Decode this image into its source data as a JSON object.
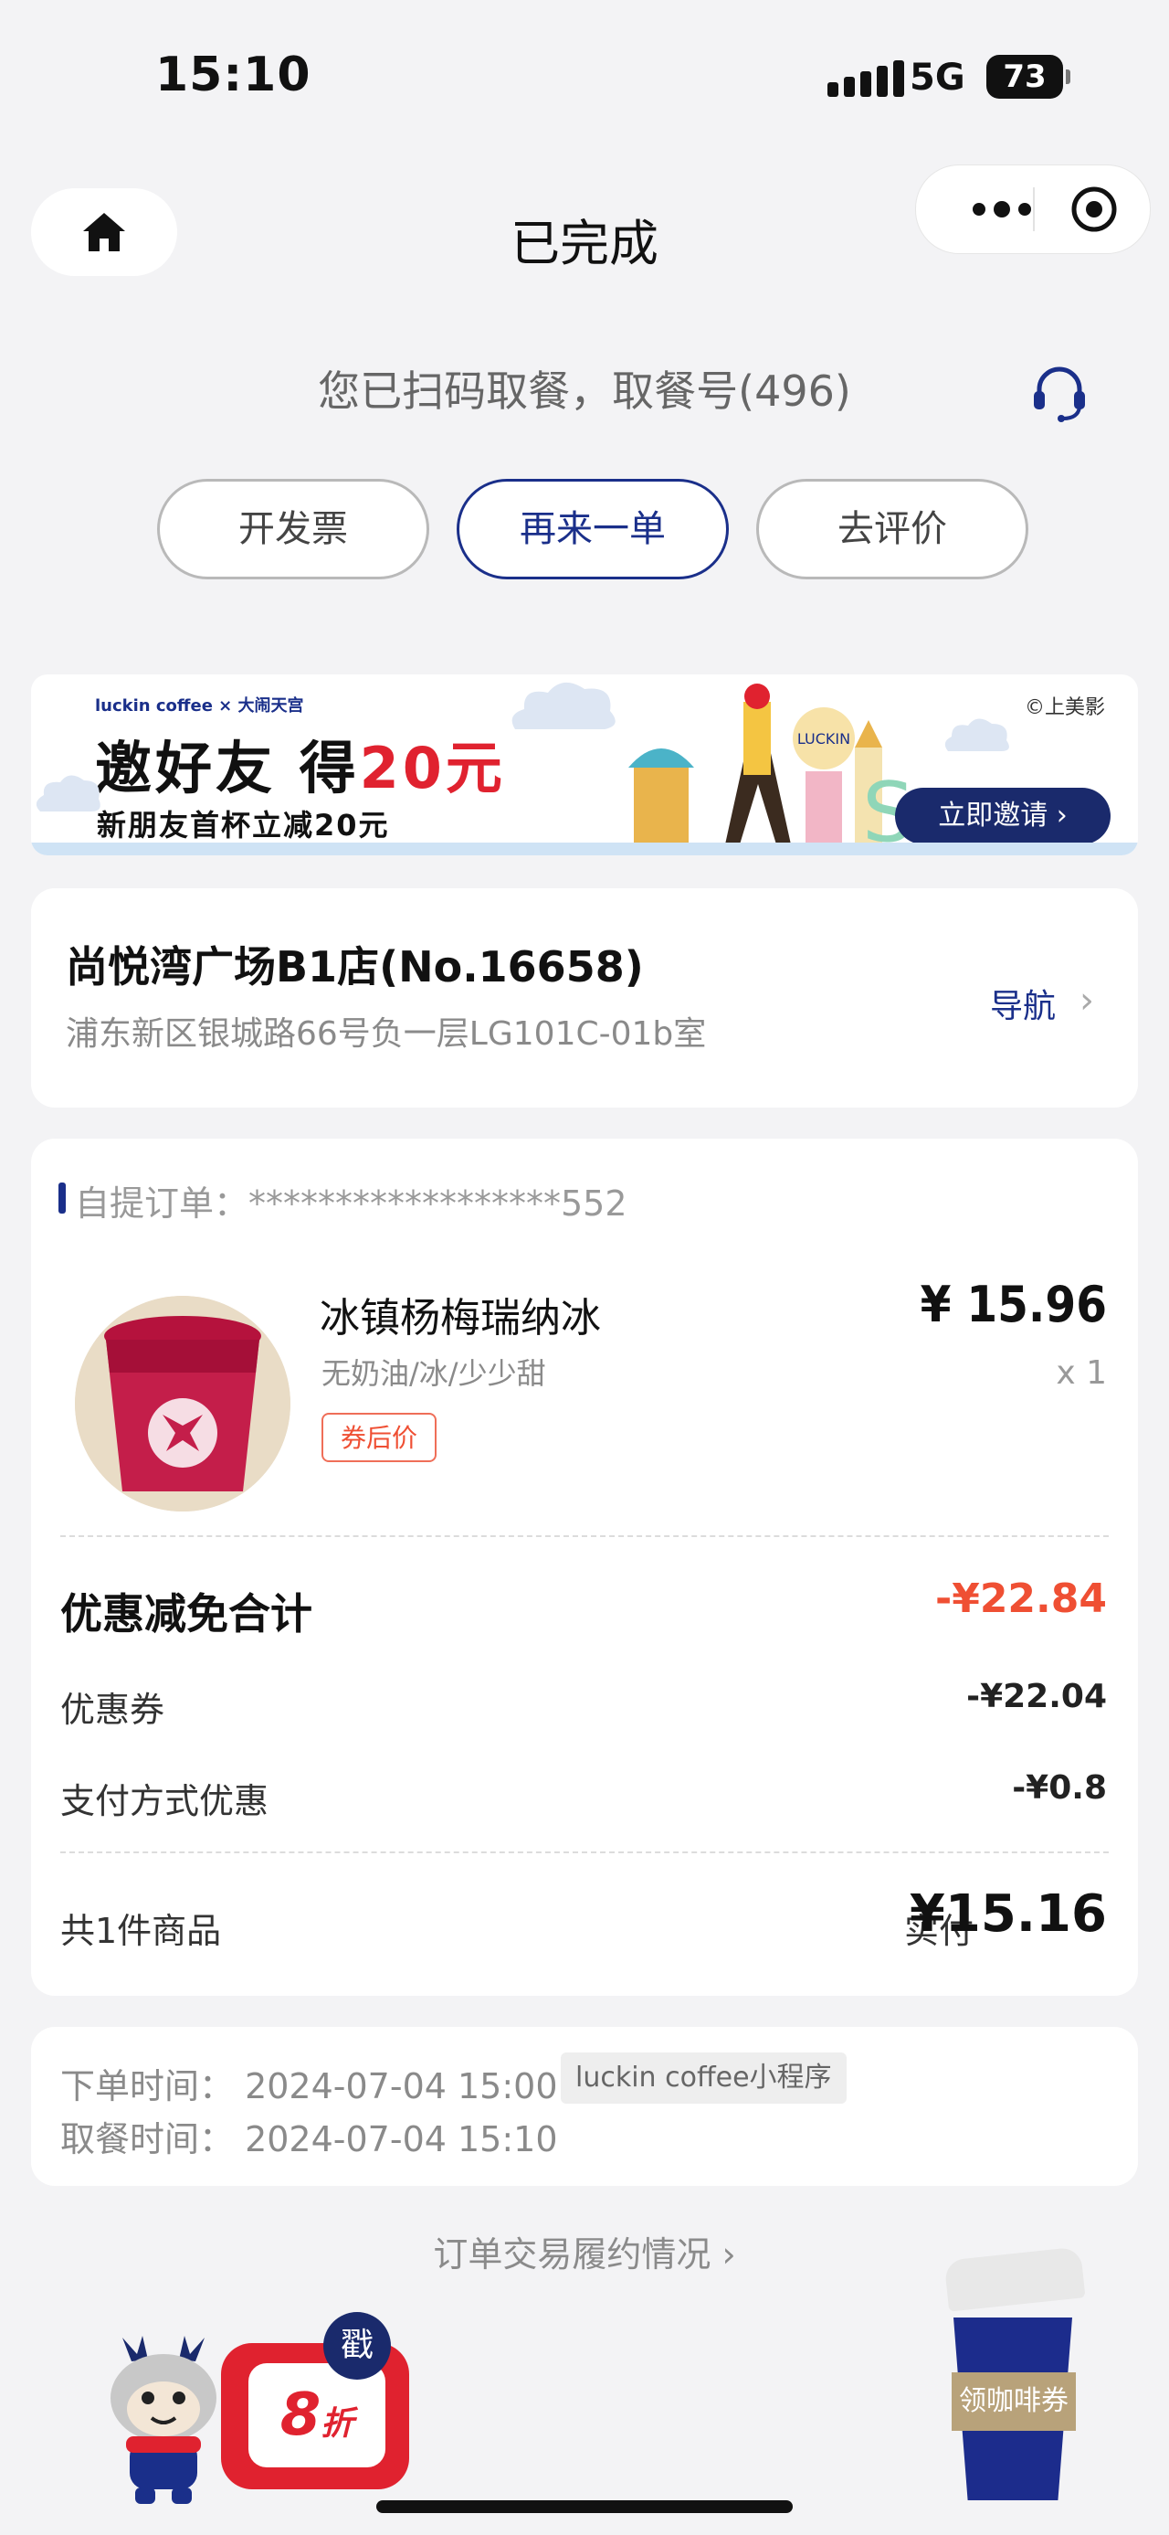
{
  "status_bar": {
    "time": "15:10",
    "network": "5G",
    "battery": "73"
  },
  "nav": {
    "title": "已完成"
  },
  "pickup": {
    "message": "您已扫码取餐，取餐号(496)"
  },
  "actions": {
    "invoice": "开发票",
    "reorder": "再来一单",
    "review": "去评价"
  },
  "banner": {
    "logo": "luckin coffee × 大闹天宫",
    "headline_prefix": "邀好友 得",
    "headline_amount": "20元",
    "subline": "新朋友首杯立减20元",
    "copyright": "©上美影",
    "invite_label": "立即邀请 ›"
  },
  "store": {
    "name": "尚悦湾广场B1店(No.16658)",
    "address": "浦东新区银城路66号负一层LG101C-01b室",
    "nav_label": "导航"
  },
  "order": {
    "label": "自提订单：******************552",
    "product": {
      "name": "冰镇杨梅瑞纳冰",
      "spec": "无奶油/冰/少少甜",
      "tag": "券后价",
      "price": "¥ 15.96",
      "qty": "x 1"
    },
    "discount_title": "优惠减免合计",
    "discount_total": "-¥22.84",
    "coupon_label": "优惠券",
    "coupon_value": "-¥22.04",
    "payment_label": "支付方式优惠",
    "payment_value": "-¥0.8",
    "count_label": "共1件商品",
    "paid_label": "实付",
    "paid_value": "¥15.16"
  },
  "times": {
    "order_time": "下单时间：  2024-07-04 15:00",
    "channel": "luckin coffee小程序",
    "pickup_time": "取餐时间：  2024-07-04 15:10"
  },
  "transaction_link": "订单交易履约情况 ›",
  "promos": {
    "discount": "8",
    "discount_unit": "折",
    "stamp": "戳",
    "coupon_cup_label": "领咖啡券"
  }
}
